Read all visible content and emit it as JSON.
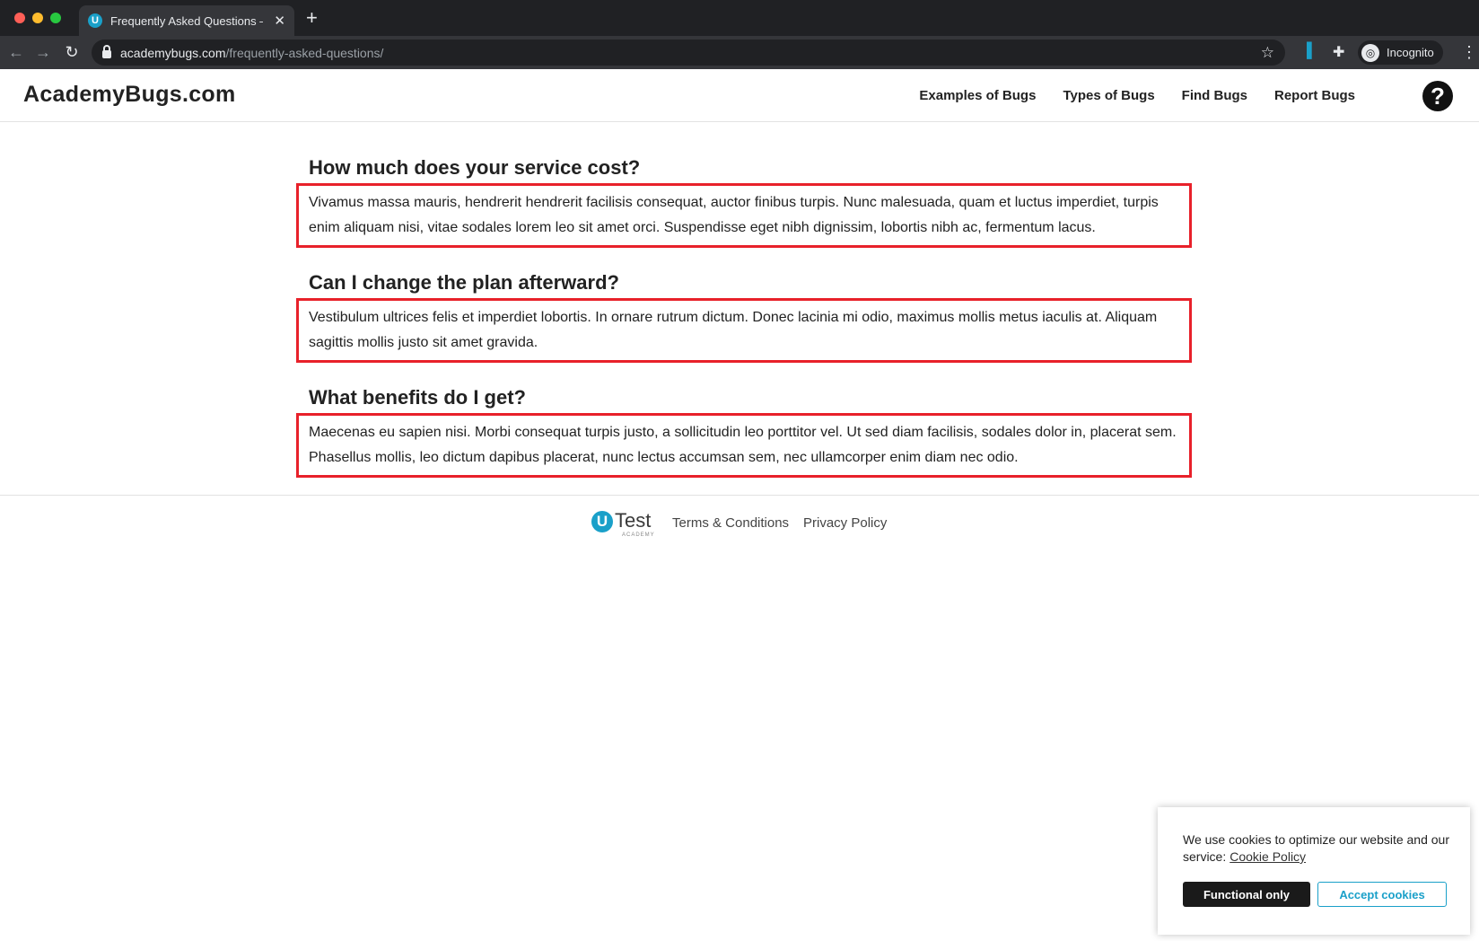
{
  "browser": {
    "tab_title": "Frequently Asked Questions – ",
    "tab_favicon_letter": "U",
    "url_host": "academybugs.com",
    "url_path": "/frequently-asked-questions/",
    "profile_label": "Incognito"
  },
  "site": {
    "logo": "AcademyBugs.com",
    "nav": [
      {
        "label": "Examples of Bugs"
      },
      {
        "label": "Types of Bugs"
      },
      {
        "label": "Find Bugs"
      },
      {
        "label": "Report Bugs"
      }
    ],
    "help_glyph": "?"
  },
  "faq": [
    {
      "question": "How much does your service cost?",
      "answer": "Vivamus massa mauris, hendrerit hendrerit facilisis consequat, auctor finibus turpis. Nunc malesuada, quam et luctus imperdiet, turpis enim aliquam nisi, vitae sodales lorem leo sit amet orci. Suspendisse eget nibh dignissim, lobortis nibh ac, fermentum lacus."
    },
    {
      "question": "Can I change the plan afterward?",
      "answer": "Vestibulum ultrices felis et imperdiet lobortis. In ornare rutrum dictum. Donec lacinia mi odio, maximus mollis metus iaculis at. Aliquam sagittis mollis justo sit amet gravida."
    },
    {
      "question": "What benefits do I get?",
      "answer": "Maecenas eu sapien nisi. Morbi consequat turpis justo, a sollicitudin leo porttitor vel. Ut sed diam facilisis, sodales dolor in, placerat sem. Phasellus mollis, leo dictum dapibus placerat, nunc lectus accumsan sem, nec ullamcorper enim diam nec odio."
    }
  ],
  "footer": {
    "logo_letter": "U",
    "logo_text": "Test",
    "logo_sub": "ACADEMY",
    "terms": "Terms & Conditions",
    "privacy": "Privacy Policy"
  },
  "cookie": {
    "text": "We use cookies to optimize our website and our service:",
    "policy_link": "Cookie Policy",
    "functional_button": "Functional only",
    "accept_button": "Accept cookies"
  },
  "colors": {
    "highlight_border": "#e8212a",
    "brand": "#1aa0c9"
  }
}
